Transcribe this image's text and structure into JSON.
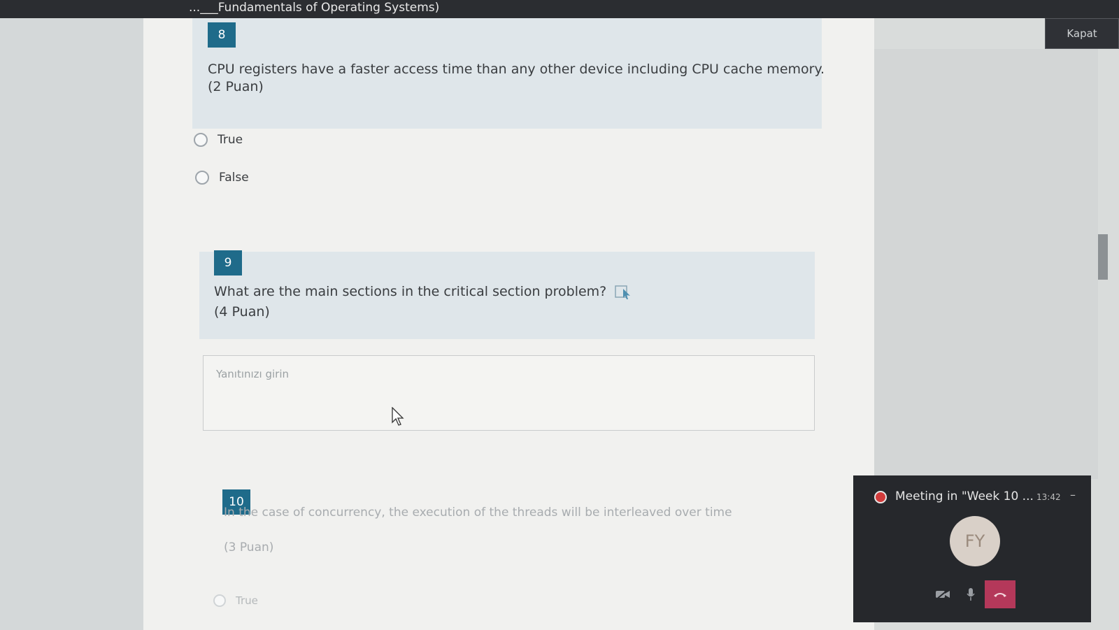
{
  "window": {
    "title": "...___Fundamentals of Operating Systems)",
    "close_label": "Kapat"
  },
  "questions": [
    {
      "number": "8",
      "text": "CPU registers have a faster access time than any other device including CPU cache memory.",
      "points": "(2 Puan)",
      "options": [
        "True",
        "False"
      ]
    },
    {
      "number": "9",
      "text": "What are the main sections in the critical section problem?",
      "points": "(4 Puan)",
      "placeholder": "Yanıtınızı girin"
    },
    {
      "number": "10",
      "text": "In the case of concurrency, the execution of the threads will be interleaved over time",
      "points": "(3 Puan)",
      "options": [
        "True"
      ]
    }
  ],
  "meeting": {
    "title": "Meeting in \"Week 10 ...",
    "time": "13:42",
    "minimize": "–",
    "avatar_initials": "FY"
  },
  "colors": {
    "accent": "#1f6b8a",
    "hangup": "#b4385a",
    "panel": "#26282c"
  }
}
